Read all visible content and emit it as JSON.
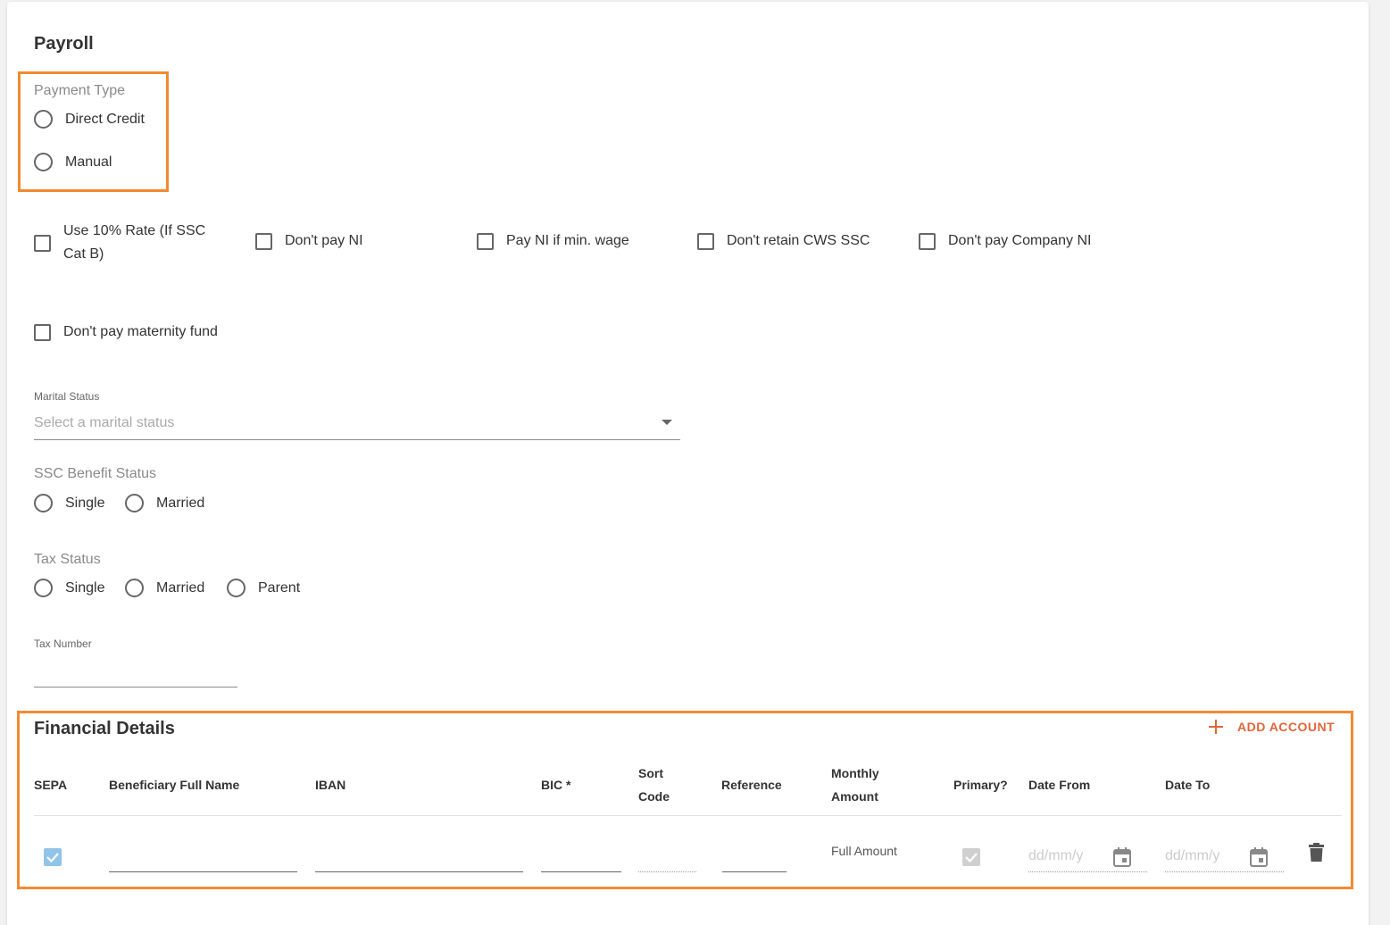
{
  "payroll": {
    "title": "Payroll",
    "payment_type": {
      "label": "Payment Type",
      "options": [
        "Direct Credit",
        "Manual"
      ]
    },
    "checkboxes": [
      "Use 10% Rate (If SSC Cat B)",
      "Don't pay NI",
      "Pay NI if min. wage",
      "Don't retain CWS SSC",
      "Don't pay Company NI",
      "Don't pay maternity fund"
    ],
    "marital_status": {
      "label": "Marital Status",
      "placeholder": "Select a marital status"
    },
    "ssc_benefit_status": {
      "label": "SSC Benefit Status",
      "options": [
        "Single",
        "Married"
      ]
    },
    "tax_status": {
      "label": "Tax Status",
      "options": [
        "Single",
        "Married",
        "Parent"
      ]
    },
    "tax_number": {
      "label": "Tax Number"
    }
  },
  "financial": {
    "title": "Financial Details",
    "add_account": "ADD ACCOUNT",
    "columns": {
      "sepa": "SEPA",
      "beneficiary": "Beneficiary Full Name",
      "iban": "IBAN",
      "bic": "BIC *",
      "sort_1": "Sort",
      "sort_2": "Code",
      "reference": "Reference",
      "monthly_1": "Monthly",
      "monthly_2": "Amount",
      "primary": "Primary?",
      "date_from": "Date From",
      "date_to": "Date To"
    },
    "row": {
      "monthly_amount": "Full Amount",
      "date_placeholder": "dd/mm/y"
    }
  },
  "colors": {
    "accent": "#f28a30",
    "add_button": "#e0663a",
    "checked_blue": "#90c4e8"
  }
}
